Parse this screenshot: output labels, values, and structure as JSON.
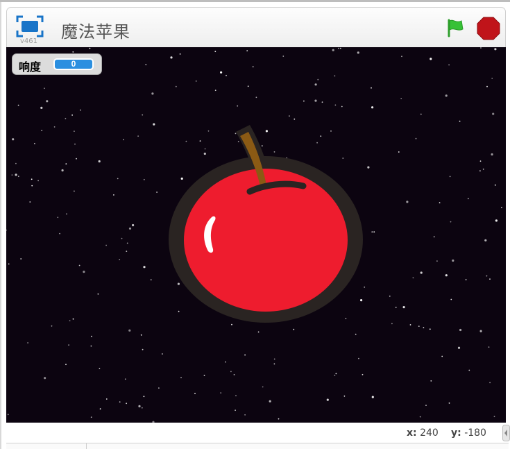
{
  "header": {
    "version": "v461",
    "title": "魔法苹果",
    "icons": {
      "present": "presentation-mode-icon",
      "flag": "green-flag-icon",
      "stop": "stop-sign-icon"
    }
  },
  "monitor": {
    "label": "响度",
    "value": "0"
  },
  "stage_info": {
    "x_label": "x:",
    "x_value": "240",
    "y_label": "y:",
    "y_value": "-180"
  },
  "colors": {
    "stage_background": "#0c0410",
    "monitor_value": "#2b8fe0",
    "flag": "#37c136",
    "stop": "#c0141a",
    "apple": "#ee1c2e",
    "stem": "#8b5a14"
  }
}
